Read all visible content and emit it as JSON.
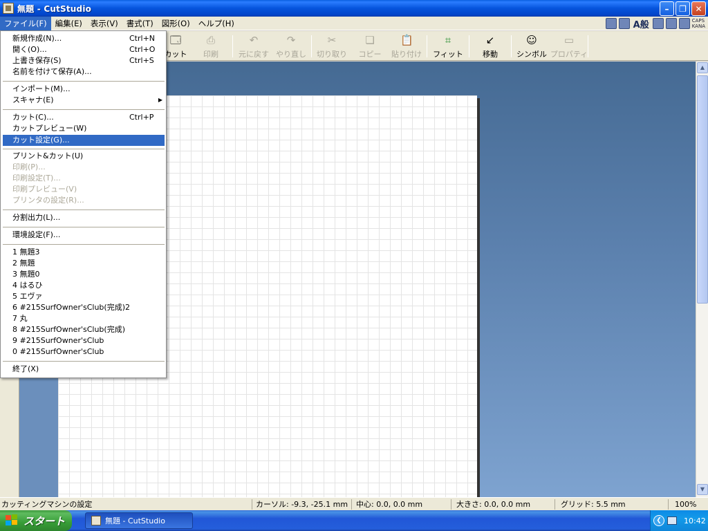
{
  "window": {
    "title": "無題 - CutStudio"
  },
  "menubar": {
    "items": [
      "ファイル(F)",
      "編集(E)",
      "表示(V)",
      "書式(T)",
      "図形(O)",
      "ヘルプ(H)"
    ],
    "ime_label": "A般",
    "caps": "CAPS",
    "kana": "KANA"
  },
  "toolbar": {
    "buttons": [
      {
        "label": "カット",
        "icon": "cut-icon",
        "enabled": true
      },
      {
        "label": "印刷",
        "icon": "print-icon",
        "enabled": false
      },
      {
        "label": "元に戻す",
        "icon": "undo-icon",
        "enabled": false
      },
      {
        "label": "やり直し",
        "icon": "redo-icon",
        "enabled": false
      },
      {
        "label": "切り取り",
        "icon": "scissors-icon",
        "enabled": false
      },
      {
        "label": "コピー",
        "icon": "copy-icon",
        "enabled": false
      },
      {
        "label": "貼り付け",
        "icon": "paste-icon",
        "enabled": false
      },
      {
        "label": "フィット",
        "icon": "fit-icon",
        "enabled": true
      },
      {
        "label": "移動",
        "icon": "move-icon",
        "enabled": true
      },
      {
        "label": "シンボル",
        "icon": "symbol-icon",
        "enabled": true
      },
      {
        "label": "プロパティ",
        "icon": "properties-icon",
        "enabled": false
      }
    ]
  },
  "file_menu": {
    "items": [
      {
        "label": "新規作成(N)...",
        "shortcut": "Ctrl+N"
      },
      {
        "label": "開く(O)...",
        "shortcut": "Ctrl+O"
      },
      {
        "label": "上書き保存(S)",
        "shortcut": "Ctrl+S"
      },
      {
        "label": "名前を付けて保存(A)...",
        "shortcut": ""
      },
      {
        "label": "インポート(M)...",
        "shortcut": ""
      },
      {
        "label": "スキャナ(E)",
        "shortcut": ""
      },
      {
        "label": "カット(C)...",
        "shortcut": "Ctrl+P"
      },
      {
        "label": "カットプレビュー(W)",
        "shortcut": ""
      },
      {
        "label": "カット設定(G)...",
        "shortcut": ""
      },
      {
        "label": "プリント&カット(U)",
        "shortcut": ""
      },
      {
        "label": "印刷(P)...",
        "shortcut": ""
      },
      {
        "label": "印刷設定(T)...",
        "shortcut": ""
      },
      {
        "label": "印刷プレビュー(V)",
        "shortcut": ""
      },
      {
        "label": "プリンタの設定(R)...",
        "shortcut": ""
      },
      {
        "label": "分割出力(L)...",
        "shortcut": ""
      },
      {
        "label": "環境設定(F)...",
        "shortcut": ""
      },
      {
        "label": "1 無題3",
        "shortcut": ""
      },
      {
        "label": "2 無題",
        "shortcut": ""
      },
      {
        "label": "3 無題0",
        "shortcut": ""
      },
      {
        "label": "4 はるひ",
        "shortcut": ""
      },
      {
        "label": "5 エヴァ",
        "shortcut": ""
      },
      {
        "label": "6 #215SurfOwner'sClub(完成)2",
        "shortcut": ""
      },
      {
        "label": "7 丸",
        "shortcut": ""
      },
      {
        "label": "8 #215SurfOwner'sClub(完成)",
        "shortcut": ""
      },
      {
        "label": "9 #215SurfOwner'sClub",
        "shortcut": ""
      },
      {
        "label": "0 #215SurfOwner'sClub",
        "shortcut": ""
      },
      {
        "label": "終了(X)",
        "shortcut": ""
      }
    ]
  },
  "statusbar": {
    "message": "カッティングマシンの設定",
    "cursor": "カーソル: -9.3, -25.1 mm",
    "center": "中心: 0.0, 0.0 mm",
    "size": "大きさ: 0.0, 0.0 mm",
    "grid": "グリッド: 5.5 mm",
    "zoom": "100%"
  },
  "taskbar": {
    "start_label": "スタート",
    "task_label": "無題 - CutStudio",
    "clock": "10:42"
  },
  "colors": {
    "selection": "#316ac5",
    "workspace_top": "#456a93",
    "workspace_bottom": "#7ea3d0"
  }
}
